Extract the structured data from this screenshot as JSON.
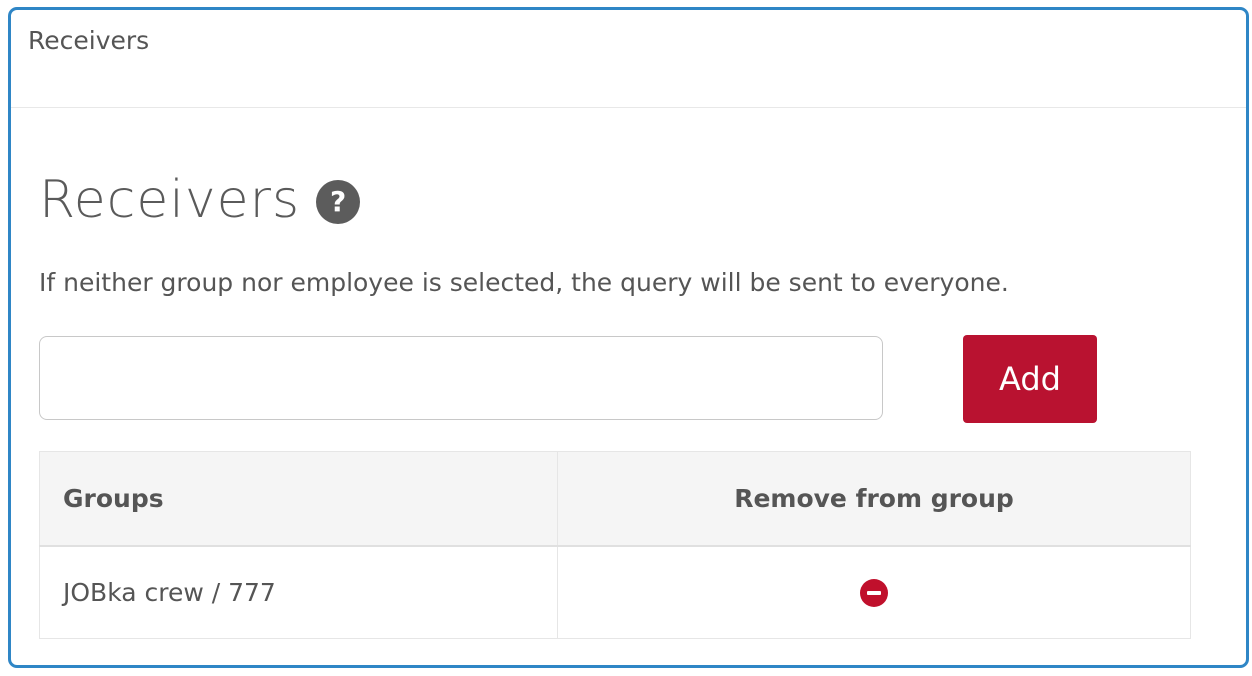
{
  "panel": {
    "title": "Receivers"
  },
  "section": {
    "heading": "Receivers",
    "help_icon": "?",
    "description": "If neither group nor employee is selected, the query will be sent to everyone."
  },
  "search": {
    "value": "",
    "placeholder": ""
  },
  "add_button": {
    "label": "Add"
  },
  "table": {
    "headers": {
      "groups": "Groups",
      "remove": "Remove from group"
    },
    "rows": [
      {
        "group": "JOBka crew / 777",
        "action_icon": "remove-circle-icon"
      }
    ]
  },
  "colors": {
    "border_accent": "#2f86c6",
    "primary_button": "#b91230",
    "remove_icon": "#c0102c"
  }
}
